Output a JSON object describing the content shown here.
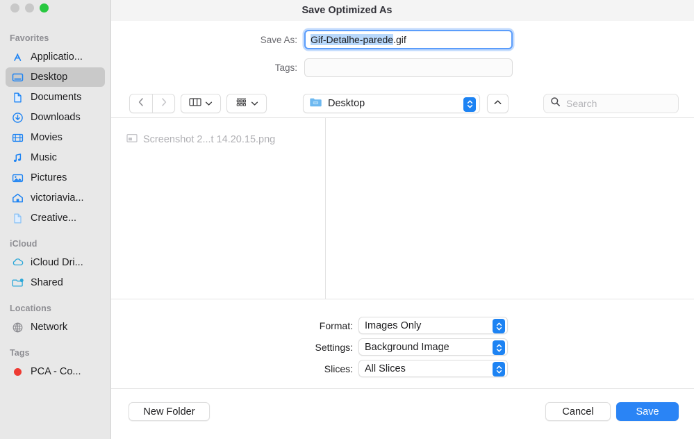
{
  "window": {
    "title": "Save Optimized As",
    "traffic_lights": [
      {
        "name": "close-button",
        "color": "#c8c8c8"
      },
      {
        "name": "minimize-button",
        "color": "#c8c8c8"
      },
      {
        "name": "zoom-button",
        "color": "#28c840"
      }
    ]
  },
  "sidebar": {
    "sections": [
      {
        "header": "Favorites",
        "items": [
          {
            "label": "Applicatio...",
            "icon": "applications-icon",
            "selected": false
          },
          {
            "label": "Desktop",
            "icon": "desktop-icon",
            "selected": true
          },
          {
            "label": "Documents",
            "icon": "document-icon",
            "selected": false
          },
          {
            "label": "Downloads",
            "icon": "downloads-icon",
            "selected": false
          },
          {
            "label": "Movies",
            "icon": "movies-icon",
            "selected": false
          },
          {
            "label": "Music",
            "icon": "music-icon",
            "selected": false
          },
          {
            "label": "Pictures",
            "icon": "pictures-icon",
            "selected": false
          },
          {
            "label": "victoriavia...",
            "icon": "home-icon",
            "selected": false
          },
          {
            "label": "Creative...",
            "icon": "document-icon",
            "selected": false
          }
        ]
      },
      {
        "header": "iCloud",
        "items": [
          {
            "label": "iCloud Dri...",
            "icon": "icloud-icon",
            "selected": false
          },
          {
            "label": "Shared",
            "icon": "shared-folder-icon",
            "selected": false
          }
        ]
      },
      {
        "header": "Locations",
        "items": [
          {
            "label": "Network",
            "icon": "network-globe-icon",
            "selected": false
          }
        ]
      },
      {
        "header": "Tags",
        "items": [
          {
            "label": "PCA - Co...",
            "icon": "red-tag-dot-icon",
            "selected": false,
            "dot_color": "#ee3b33"
          }
        ]
      }
    ]
  },
  "fields": {
    "save_as": {
      "label": "Save As:",
      "value_selected": "Gif-Detalhe-parede",
      "value_tail": ".gif",
      "full_value": "Gif-Detalhe-parede.gif"
    },
    "tags": {
      "label": "Tags:",
      "value": "",
      "placeholder": ""
    }
  },
  "toolbar": {
    "back_icon": "chevron-left-icon",
    "forward_icon": "chevron-right-icon",
    "view_columns_icon": "column-view-icon",
    "view_grid_icon": "gallery-view-icon",
    "path": {
      "label": "Desktop",
      "icon": "folder-icon"
    },
    "up_icon": "chevron-up-icon",
    "search": {
      "placeholder": "Search",
      "icon": "search-icon",
      "value": ""
    }
  },
  "browser": {
    "columns": [
      {
        "files": [
          {
            "name": "Screenshot 2...t 14.20.15.png",
            "icon": "image-file-icon",
            "dimmed": true
          }
        ]
      },
      {
        "files": []
      }
    ]
  },
  "options": {
    "rows": [
      {
        "label": "Format:",
        "value": "Images Only",
        "name": "format-popup"
      },
      {
        "label": "Settings:",
        "value": "Background Image",
        "name": "settings-popup"
      },
      {
        "label": "Slices:",
        "value": "All Slices",
        "name": "slices-popup"
      }
    ]
  },
  "footer": {
    "new_folder": "New Folder",
    "cancel": "Cancel",
    "save": "Save"
  },
  "colors": {
    "accent": "#2a84f5",
    "stepper": "#1d83f3",
    "selection": "#b8d8fb",
    "sidebar_bg": "#e8e8e8",
    "titlebar_bg": "#f4f4f4",
    "green_light": "#28c840",
    "tag_red": "#ee3b33"
  }
}
